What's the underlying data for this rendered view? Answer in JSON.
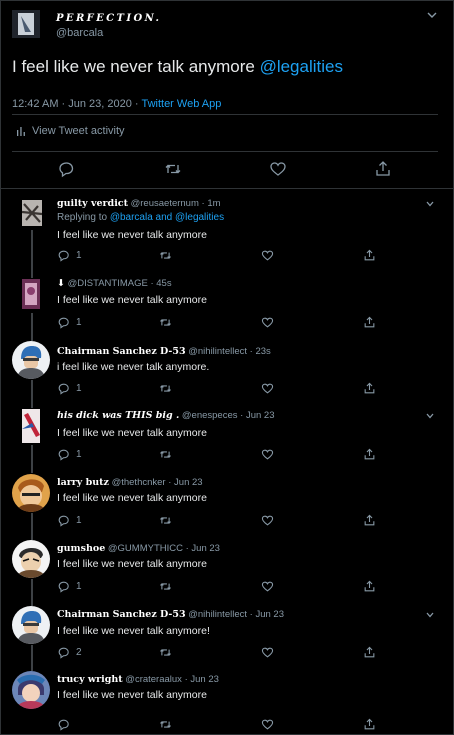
{
  "main_tweet": {
    "display_name": "PERFECTION.",
    "handle": "@barcala",
    "text": "I feel like we never talk anymore ",
    "mention": "@legalities",
    "timestamp": "12:42 AM · Jun 23, 2020 · ",
    "client": "Twitter Web App",
    "activity_label": "View Tweet activity"
  },
  "replies": [
    {
      "name": "guilty verdict",
      "handle": "@reusaeternum",
      "time": "· 1m",
      "replying_prefix": "Replying to ",
      "replying_to": "@barcala and @legalities",
      "text": "I feel like we never talk anymore",
      "reply_count": "1",
      "retweet_count": "",
      "like_count": ""
    },
    {
      "name": "",
      "handle": "@DISTANTIMAGE",
      "time": "· 45s",
      "text": "I feel like we never talk anymore",
      "reply_count": "1",
      "retweet_count": "",
      "like_count": ""
    },
    {
      "name": "Chairman Sanchez D-53",
      "handle": "@nihilintellect",
      "time": "· 23s",
      "text": "i feel like we never talk anymore.",
      "reply_count": "1",
      "retweet_count": "",
      "like_count": ""
    },
    {
      "name": "his dick was THIS big .",
      "handle": "@enespeces",
      "time": "· Jun 23",
      "text": "I feel like we never talk anymore",
      "reply_count": "1",
      "retweet_count": "",
      "like_count": ""
    },
    {
      "name": "larry butz",
      "handle": "@thethcnker",
      "time": "· Jun 23",
      "text": "I feel like we never talk anymore",
      "reply_count": "1",
      "retweet_count": "",
      "like_count": ""
    },
    {
      "name": "gumshoe",
      "handle": "@GUMMYTHICC",
      "time": "· Jun 23",
      "text": "I feel like we never talk anymore",
      "reply_count": "1",
      "retweet_count": "",
      "like_count": ""
    },
    {
      "name": "Chairman Sanchez D-53",
      "handle": "@nihilintellect",
      "time": "· Jun 23",
      "text": "I feel like we never talk anymore!",
      "reply_count": "2",
      "retweet_count": "",
      "like_count": ""
    },
    {
      "name": "trucy wright",
      "handle": "@crateraalux",
      "time": "· Jun 23",
      "text": "I feel like we never talk anymore",
      "reply_count": "",
      "retweet_count": "",
      "like_count": ""
    }
  ],
  "icons": {
    "reply": "reply-icon",
    "retweet": "retweet-icon",
    "like": "heart-icon",
    "share": "share-icon",
    "caret": "chevron-down-icon",
    "activity": "bar-chart-icon"
  },
  "colors": {
    "background": "#000000",
    "accent": "#1da1f2",
    "muted": "#8899a6",
    "divider": "#2f3336"
  }
}
